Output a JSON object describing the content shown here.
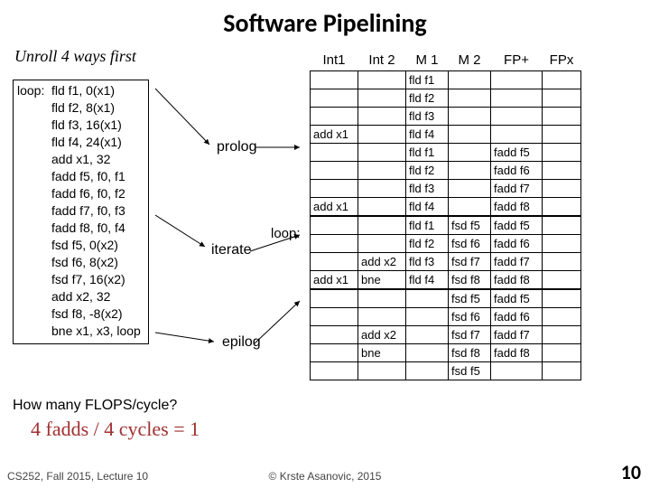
{
  "title": "Software Pipelining",
  "subtitle": "Unroll 4 ways first",
  "code": {
    "label": "loop:",
    "lines": [
      "fld f1, 0(x1)",
      "fld f2, 8(x1)",
      "fld f3, 16(x1)",
      "fld f4, 24(x1)",
      "add x1, 32",
      "fadd f5, f0, f1",
      "fadd f6, f0, f2",
      "fadd f7, f0, f3",
      "fadd f8, f0, f4",
      "fsd f5, 0(x2)",
      "fsd f6, 8(x2)",
      "fsd f7, 16(x2)",
      "add x2, 32",
      "fsd f8, -8(x2)",
      "bne x1, x3, loop"
    ]
  },
  "stages": {
    "prolog": "prolog",
    "iterate": "iterate",
    "loop": "loop:",
    "epilog": "epilog"
  },
  "headers": [
    "Int1",
    "Int 2",
    "M 1",
    "M 2",
    "FP+",
    "FPx"
  ],
  "rows": [
    {
      "int1": "",
      "int2": "",
      "m1": "fld f1",
      "m2": "",
      "fpp": "",
      "fpx": ""
    },
    {
      "int1": "",
      "int2": "",
      "m1": "fld f2",
      "m2": "",
      "fpp": "",
      "fpx": ""
    },
    {
      "int1": "",
      "int2": "",
      "m1": "fld f3",
      "m2": "",
      "fpp": "",
      "fpx": ""
    },
    {
      "int1": "add x1",
      "int2": "",
      "m1": "fld f4",
      "m2": "",
      "fpp": "",
      "fpx": ""
    },
    {
      "int1": "",
      "int2": "",
      "m1": "fld f1",
      "m2": "",
      "fpp": "fadd f5",
      "fpx": ""
    },
    {
      "int1": "",
      "int2": "",
      "m1": "fld f2",
      "m2": "",
      "fpp": "fadd f6",
      "fpx": ""
    },
    {
      "int1": "",
      "int2": "",
      "m1": "fld f3",
      "m2": "",
      "fpp": "fadd f7",
      "fpx": ""
    },
    {
      "int1": "add x1",
      "int2": "",
      "m1": "fld f4",
      "m2": "",
      "fpp": "fadd f8",
      "fpx": ""
    },
    {
      "int1": "",
      "int2": "",
      "m1": "fld f1",
      "m2": "fsd f5",
      "fpp": "fadd f5",
      "fpx": ""
    },
    {
      "int1": "",
      "int2": "",
      "m1": "fld f2",
      "m2": "fsd f6",
      "fpp": "fadd f6",
      "fpx": ""
    },
    {
      "int1": "",
      "int2": "add x2",
      "m1": "fld f3",
      "m2": "fsd f7",
      "fpp": "fadd f7",
      "fpx": ""
    },
    {
      "int1": "add x1",
      "int2": "bne",
      "m1": "fld f4",
      "m2": "fsd f8",
      "fpp": "fadd f8",
      "fpx": ""
    },
    {
      "int1": "",
      "int2": "",
      "m1": "",
      "m2": "fsd f5",
      "fpp": "fadd f5",
      "fpx": ""
    },
    {
      "int1": "",
      "int2": "",
      "m1": "",
      "m2": "fsd f6",
      "fpp": "fadd f6",
      "fpx": ""
    },
    {
      "int1": "",
      "int2": "add x2",
      "m1": "",
      "m2": "fsd f7",
      "fpp": "fadd f7",
      "fpx": ""
    },
    {
      "int1": "",
      "int2": "bne",
      "m1": "",
      "m2": "fsd f8",
      "fpp": "fadd f8",
      "fpx": ""
    },
    {
      "int1": "",
      "int2": "",
      "m1": "",
      "m2": "fsd f5",
      "fpp": "",
      "fpx": ""
    }
  ],
  "question": "How many FLOPS/cycle?",
  "answer": "4 fadds / 4 cycles = 1",
  "footer": {
    "left": "CS252, Fall 2015, Lecture 10",
    "center": "© Krste Asanovic, 2015",
    "right": "10"
  }
}
